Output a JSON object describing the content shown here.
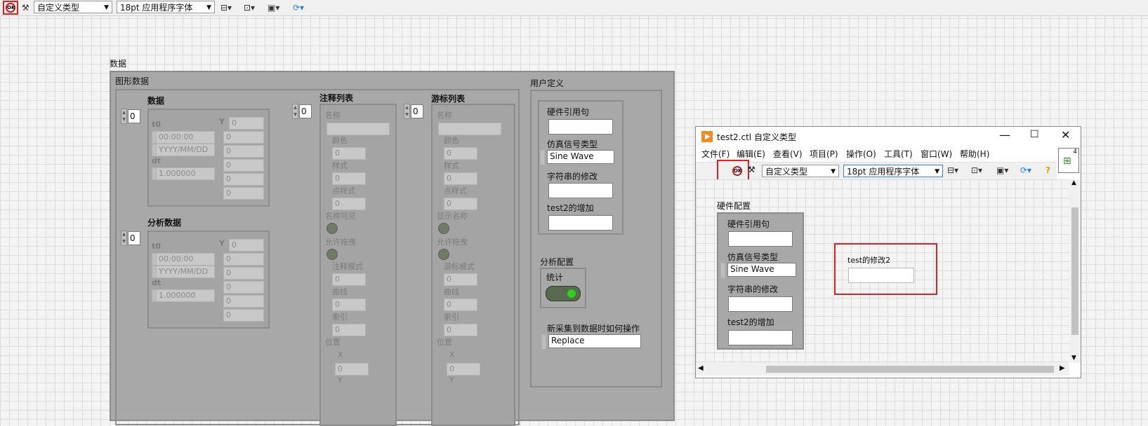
{
  "toolbar": {
    "run_icon": "ok-icon",
    "font_select": "自定义类型",
    "size_select": "18pt 应用程序字体"
  },
  "front_panel": {
    "data_label": "数据",
    "graph_data_label": "图形数据",
    "user_defined_label": "用户定义",
    "data_sub": {
      "label": "数据",
      "index": "0",
      "t0_label": "t0",
      "time": "00:00:00",
      "date": "YYYY/MM/DD",
      "dt_label": "dt",
      "dt_value": "1.000000",
      "y_label": "Y",
      "y_values": [
        "0",
        "0",
        "0",
        "0",
        "0",
        "0"
      ]
    },
    "analysis_sub": {
      "label": "分析数据",
      "index": "0",
      "t0_label": "t0",
      "time": "00:00:00",
      "date": "YYYY/MM/DD",
      "dt_label": "dt",
      "dt_value": "1.000000",
      "y_label": "Y",
      "y_values": [
        "0",
        "0",
        "0",
        "0",
        "0",
        "0"
      ]
    },
    "annotation_list": {
      "label": "注释列表",
      "index": "0",
      "name_label": "名称",
      "color_label": "颜色",
      "style_label": "样式",
      "point_style_label": "点样式",
      "name_visible_label": "名称可见",
      "allow_drag_label": "允许拖曳",
      "mode_label": "注释模式",
      "curve_label": "曲线",
      "index_label": "索引",
      "position_label": "位置",
      "x_label": "X",
      "y_label": "Y",
      "zero": "0"
    },
    "cursor_list": {
      "label": "游标列表",
      "index": "0",
      "name_label": "名称",
      "color_label": "颜色",
      "style_label": "样式",
      "point_style_label": "点样式",
      "show_name_label": "显示名称",
      "allow_drag_label": "允许拖曳",
      "mode_label": "游标模式",
      "curve_label": "曲线",
      "index_label": "索引",
      "position_label": "位置",
      "x_label": "X",
      "y_label": "Y",
      "zero": "0"
    },
    "user_cluster": {
      "hw_ref_label": "硬件引用句",
      "hw_ref_value": "",
      "sim_type_label": "仿真信号类型",
      "sim_type_value": "Sine Wave",
      "string_mod_label": "字符串的修改",
      "string_mod_value": "",
      "test2_add_label": "test2的增加",
      "test2_add_value": ""
    },
    "analysis_config": {
      "label": "分析配置",
      "stats_label": "统计"
    },
    "new_data_label": "新采集到数据时如何操作",
    "new_data_value": "Replace"
  },
  "window2": {
    "title": "test2.ctl 自定义类型",
    "menu": [
      "文件(F)",
      "编辑(E)",
      "查看(V)",
      "项目(P)",
      "操作(O)",
      "工具(T)",
      "窗口(W)",
      "帮助(H)"
    ],
    "font_select": "自定义类型",
    "size_select": "18pt 应用程序字体",
    "hw_config_label": "硬件配置",
    "hw_ref_label": "硬件引用句",
    "hw_ref_value": "",
    "sim_type_label": "仿真信号类型",
    "sim_type_value": "Sine Wave",
    "string_mod_label": "字符串的修改",
    "string_mod_value": "",
    "test2_add_label": "test2的增加",
    "test2_add_value": "",
    "test_mod2_label": "test的修改2",
    "test_mod2_value": "",
    "corner_number": "4"
  }
}
